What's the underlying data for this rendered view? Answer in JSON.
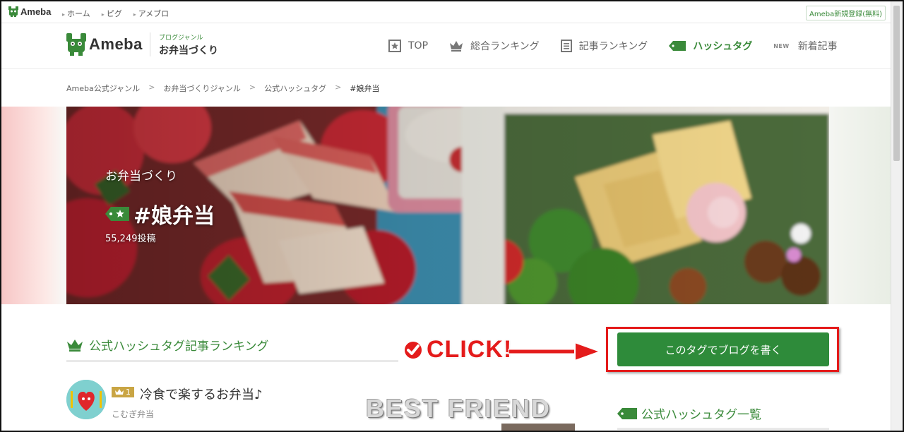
{
  "topbar": {
    "brand": "Ameba",
    "links": [
      "ホーム",
      "ピグ",
      "アメブロ"
    ],
    "register": "Ameba新規登録(無料)"
  },
  "header": {
    "logo": "Ameba",
    "genre_small": "ブログジャンル",
    "genre_name": "お弁当づくり",
    "nav": [
      {
        "label": "TOP",
        "icon": "star-box-icon"
      },
      {
        "label": "総合ランキング",
        "icon": "crown-icon"
      },
      {
        "label": "記事ランキング",
        "icon": "document-icon"
      },
      {
        "label": "ハッシュタグ",
        "icon": "hashtag-tag-icon",
        "active": true
      },
      {
        "label": "新着記事",
        "icon": "new-icon",
        "badge": "NEW"
      }
    ]
  },
  "breadcrumb": [
    "Ameba公式ジャンル",
    "お弁当づくりジャンル",
    "公式ハッシュタグ",
    "#娘弁当"
  ],
  "hero": {
    "genre": "お弁当づくり",
    "tag": "#娘弁当",
    "posts": "55,249投稿"
  },
  "ranking": {
    "title": "公式ハッシュタグ記事ランキング",
    "entries": [
      {
        "rank": "1",
        "title": "冷食で楽するお弁当♪",
        "author": "こむぎ弁当"
      }
    ]
  },
  "annotation": {
    "click": "CLICK!",
    "overlay_text": "BEST  FRIEND",
    "accent": "#e41b1b"
  },
  "sidebar": {
    "write_button": "このタグでブログを書く",
    "hashtag_list_title": "公式ハッシュタグ一覧"
  },
  "colors": {
    "brand_green": "#3a8a3a",
    "button_green": "#2e8b3a",
    "rank_gold": "#c9a544"
  }
}
